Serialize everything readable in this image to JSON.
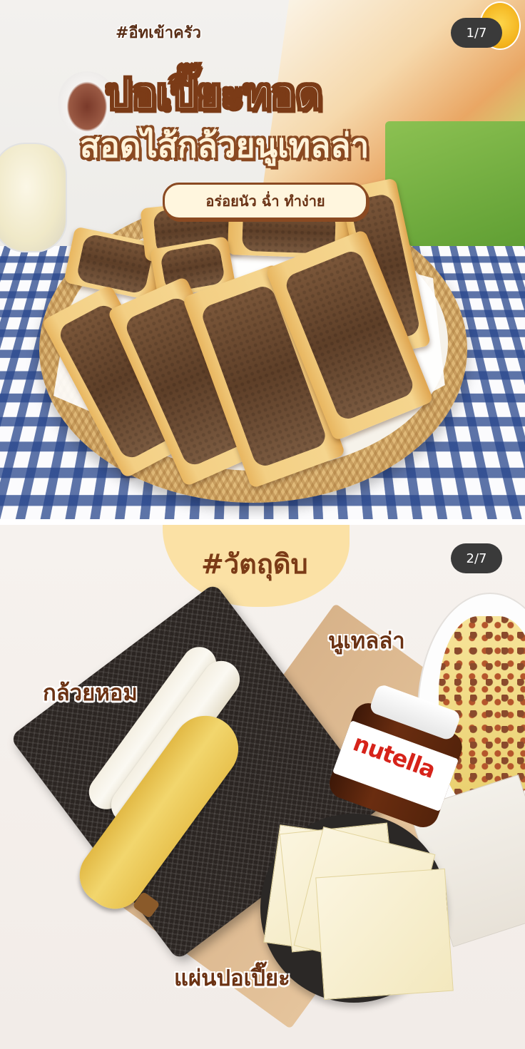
{
  "slide1": {
    "hashtag": "#อีทเข้าครัว",
    "title_line1": "ปอเปี๊ยะทอด",
    "title_line2": "สอดไส้กล้วยนูเทลล่า",
    "subtitle": "อร่อยนัว ฉ่ำ ทำง่าย",
    "counter": "1/7",
    "logo": "eat-logo-badge"
  },
  "slide2": {
    "hashtag": "#วัตถุดิบ",
    "counter": "2/7",
    "labels": {
      "banana": "กล้วยหอม",
      "nutella": "นูเทลล่า",
      "wrapper": "แผ่นปอเปี๊ยะ"
    },
    "jar_brand": "nutella"
  },
  "colors": {
    "title_brown": "#7b3b17",
    "pill_bg": "#fff6de",
    "counter_bg": "#3a3a3a",
    "blob_yellow": "#fbe1a5"
  }
}
